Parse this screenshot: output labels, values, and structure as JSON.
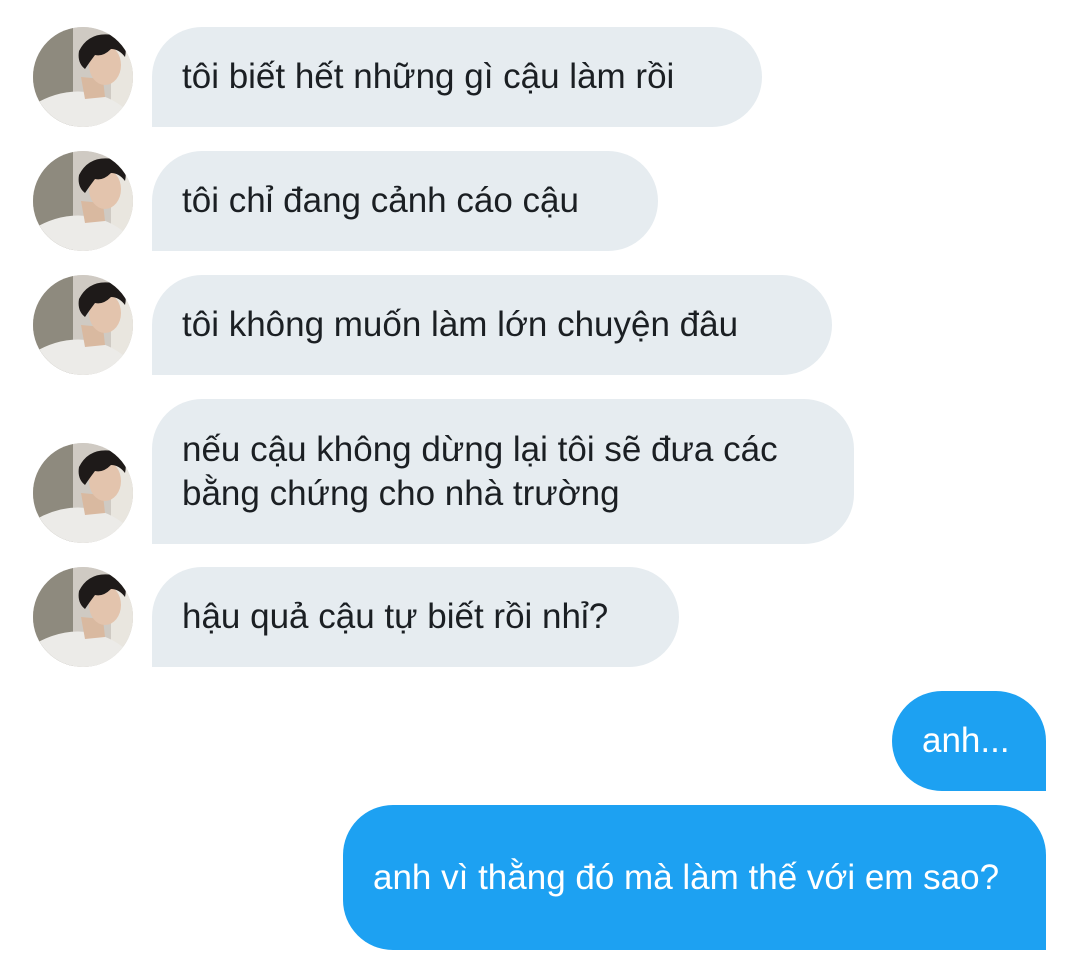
{
  "conversation": {
    "incoming": [
      {
        "text": "tôi biết hết những gì cậu làm rồi"
      },
      {
        "text": "tôi chỉ đang cảnh cáo cậu"
      },
      {
        "text": "tôi không muốn làm lớn chuyện đâu"
      },
      {
        "text": "nếu cậu không dừng lại tôi sẽ đưa các bằng chứng cho nhà trường"
      },
      {
        "text": "hậu quả cậu tự biết rồi nhỉ?"
      }
    ],
    "outgoing": [
      {
        "text": "anh..."
      },
      {
        "text": "anh vì thằng đó mà làm thế với em sao?"
      }
    ]
  },
  "colors": {
    "incoming_bubble": "#e6ecf0",
    "outgoing_bubble": "#1da1f2",
    "incoming_text": "#1b1f23",
    "outgoing_text": "#ffffff"
  },
  "icons": {
    "avatar": "sender-avatar-photo"
  }
}
